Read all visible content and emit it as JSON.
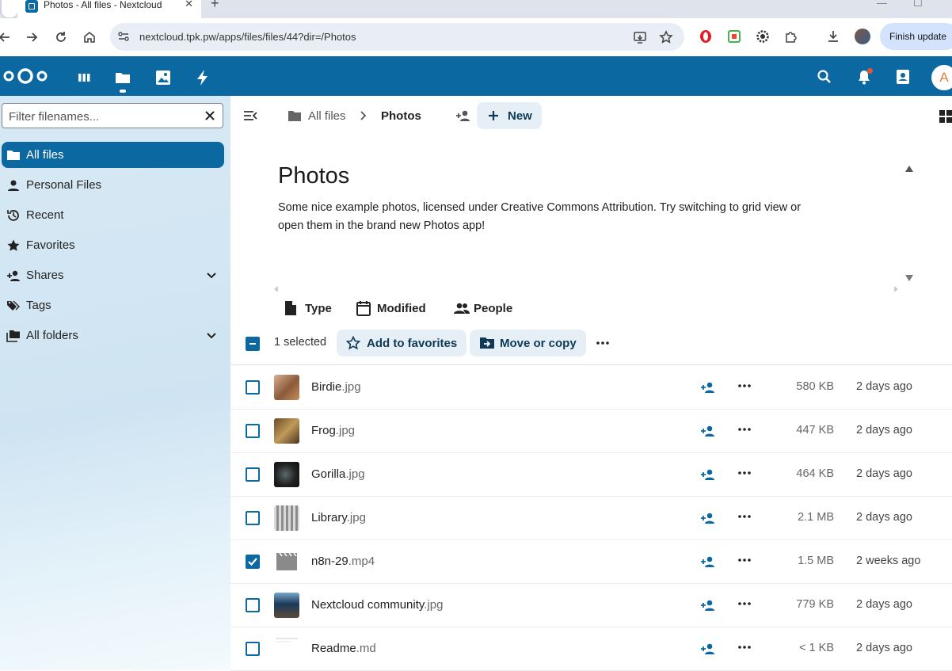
{
  "browser": {
    "tab_title": "Photos - All files - Nextcloud",
    "url": "nextcloud.tpk.pw/apps/files/files/44?dir=/Photos",
    "finish_update_label": "Finish update"
  },
  "nc_header": {
    "avatar_letter": "A",
    "apps": [
      "dashboard",
      "files",
      "photos",
      "activity"
    ],
    "active_app": "files"
  },
  "sidebar": {
    "filter_placeholder": "Filter filenames...",
    "items": [
      {
        "label": "All files",
        "icon": "folder-icon",
        "active": true
      },
      {
        "label": "Personal Files",
        "icon": "person-icon"
      },
      {
        "label": "Recent",
        "icon": "history-icon"
      },
      {
        "label": "Favorites",
        "icon": "star-icon"
      },
      {
        "label": "Shares",
        "icon": "share-icon",
        "expandable": true
      },
      {
        "label": "Tags",
        "icon": "tag-icon"
      },
      {
        "label": "All folders",
        "icon": "folders-icon",
        "expandable": true
      }
    ]
  },
  "breadcrumb": {
    "root": "All files",
    "current": "Photos",
    "new_label": "New"
  },
  "readme": {
    "title": "Photos",
    "text": "Some nice example photos, licensed under Creative Commons Attribution. Try switching to grid view or open them in the brand new Photos app!"
  },
  "filters": [
    "Type",
    "Modified",
    "People"
  ],
  "selection": {
    "count_text": "1 selected",
    "add_favorites_label": "Add to favorites",
    "move_copy_label": "Move or copy"
  },
  "files": [
    {
      "base": "Birdie",
      "ext": ".jpg",
      "size": "580 KB",
      "modified": "2 days ago",
      "checked": false,
      "thumb": "photo-bird"
    },
    {
      "base": "Frog",
      "ext": ".jpg",
      "size": "447 KB",
      "modified": "2 days ago",
      "checked": false,
      "thumb": "photo-frog"
    },
    {
      "base": "Gorilla",
      "ext": ".jpg",
      "size": "464 KB",
      "modified": "2 days ago",
      "checked": false,
      "thumb": "photo-gorilla"
    },
    {
      "base": "Library",
      "ext": ".jpg",
      "size": "2.1 MB",
      "modified": "2 days ago",
      "checked": false,
      "thumb": "photo-library"
    },
    {
      "base": "n8n-29",
      "ext": ".mp4",
      "size": "1.5 MB",
      "modified": "2 weeks ago",
      "checked": true,
      "thumb": "video-icon"
    },
    {
      "base": "Nextcloud community",
      "ext": ".jpg",
      "size": "779 KB",
      "modified": "2 days ago",
      "checked": false,
      "thumb": "photo-community"
    },
    {
      "base": "Readme",
      "ext": ".md",
      "size": "< 1 KB",
      "modified": "2 days ago",
      "checked": false,
      "thumb": "document-icon"
    }
  ],
  "colors": {
    "primary": "#0b68a0",
    "pill_bg": "#e5eff5",
    "pill_text": "#0e3a57"
  }
}
